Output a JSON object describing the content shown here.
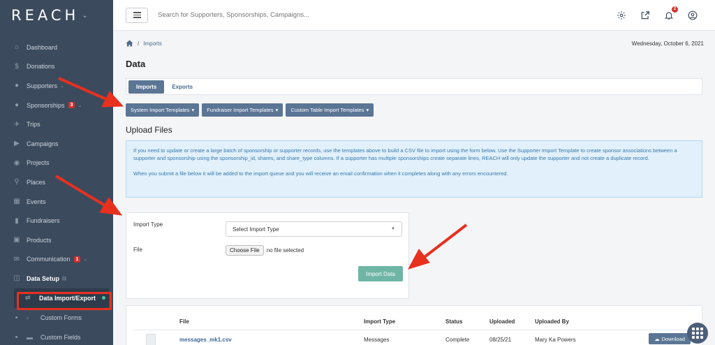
{
  "app": {
    "logo": "REACH",
    "search_placeholder": "Search for Supporters, Sponsorships, Campaigns...",
    "notification_count": "2"
  },
  "sidebar": {
    "items": [
      {
        "label": "Dashboard",
        "icon": "dashboard-icon"
      },
      {
        "label": "Donations",
        "icon": "dollar-icon"
      },
      {
        "label": "Supporters",
        "icon": "users-icon"
      },
      {
        "label": "Sponsorships",
        "icon": "user-icon",
        "badge": "3"
      },
      {
        "label": "Trips",
        "icon": "plane-icon"
      },
      {
        "label": "Campaigns",
        "icon": "megaphone-icon"
      },
      {
        "label": "Projects",
        "icon": "globe-icon"
      },
      {
        "label": "Places",
        "icon": "map-pin-icon"
      },
      {
        "label": "Events",
        "icon": "calendar-icon"
      },
      {
        "label": "Fundraisers",
        "icon": "thermometer-icon"
      },
      {
        "label": "Products",
        "icon": "basket-icon"
      },
      {
        "label": "Communication",
        "icon": "envelope-icon",
        "badge": "1"
      },
      {
        "label": "Data Setup",
        "icon": "database-icon"
      }
    ],
    "sub_items": [
      {
        "label": "Data Import/Export",
        "icon": "exchange-icon"
      },
      {
        "label": "Custom Forms",
        "icon": "file-icon"
      },
      {
        "label": "Custom Fields",
        "icon": "folder-icon"
      }
    ]
  },
  "page": {
    "breadcrumb": "Imports",
    "date": "Wednesday, October 6, 2021",
    "title": "Data",
    "tabs": [
      "Imports",
      "Exports"
    ],
    "template_buttons": [
      "System Import Templates",
      "Fundraiser Import Templates",
      "Custom Table Import Templates"
    ],
    "upload_heading": "Upload Files",
    "info_p1": "If you need to update or create a large batch of sponsorship or supporter records, use the templates above to build a CSV file to import using the form below. Use the Supporter Import Template to create sponsor associations between a supporter and sponsorship using the sponsorship_id, shares, and share_type columns. If a supporter has multiple sponsorships create separate lines, REACH will only update the supporter and not create a duplicate record.",
    "info_p2": "When you submit a file below it will be added to the import queue and you will receive an email confirmation when it completes along with any errors encountered."
  },
  "form": {
    "import_type_label": "Import Type",
    "import_type_value": "Select Import Type",
    "file_label": "File",
    "choose_file": "Choose File",
    "no_file": "no file selected",
    "submit": "Import Data"
  },
  "table": {
    "headers": [
      "File",
      "Import Type",
      "Status",
      "Uploaded",
      "Uploaded By"
    ],
    "rows": [
      {
        "file": "messages_mk1.csv",
        "import_type": "Messages",
        "status": "Complete",
        "uploaded": "08/25/21",
        "uploaded_by": "Mary Ka Powers",
        "action": "Download"
      }
    ]
  },
  "colors": {
    "sidebar_bg": "#3b4a5d",
    "accent": "#5b7595",
    "import_button": "#6fb5a6",
    "annotation_red": "#e8301f"
  }
}
